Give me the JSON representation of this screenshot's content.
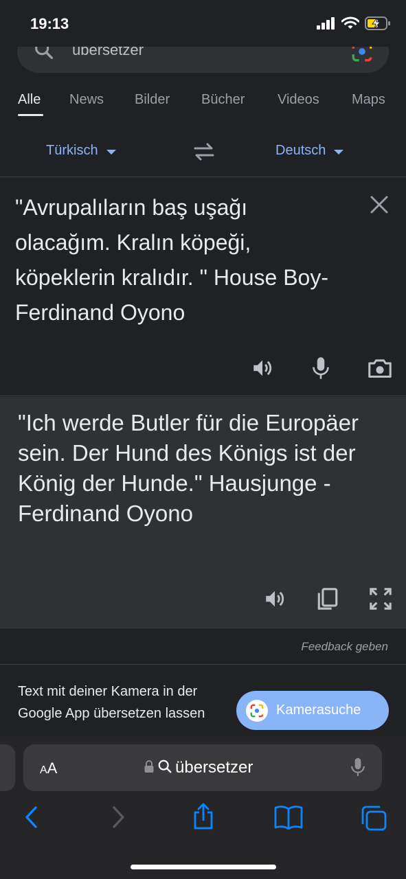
{
  "status": {
    "time": "19:13"
  },
  "search": {
    "query": "übersetzer"
  },
  "tabs": [
    {
      "label": "Alle",
      "active": true
    },
    {
      "label": "News"
    },
    {
      "label": "Bilder"
    },
    {
      "label": "Bücher"
    },
    {
      "label": "Videos"
    },
    {
      "label": "Maps"
    }
  ],
  "translator": {
    "source_lang": "Türkisch",
    "target_lang": "Deutsch",
    "source_text": "\"Avrupalıların baş uşağı olacağım. Kralın köpeği, köpeklerin kralıdır. \" House Boy- Ferdinand Oyono",
    "target_text": "\"Ich werde Butler für die Europäer sein. Der Hund des Königs ist der König der Hunde.\" Hausjunge - Ferdinand Oyono",
    "feedback": "Feedback geben"
  },
  "promo": {
    "text": "Text mit deiner Kamera in der Google App übersetzen lassen",
    "button": "Kamerasuche"
  },
  "safari": {
    "aa_label": "AA",
    "url": "übersetzer"
  },
  "colors": {
    "accent": "#8ab4f8",
    "background": "#202124",
    "panel": "#303134"
  }
}
